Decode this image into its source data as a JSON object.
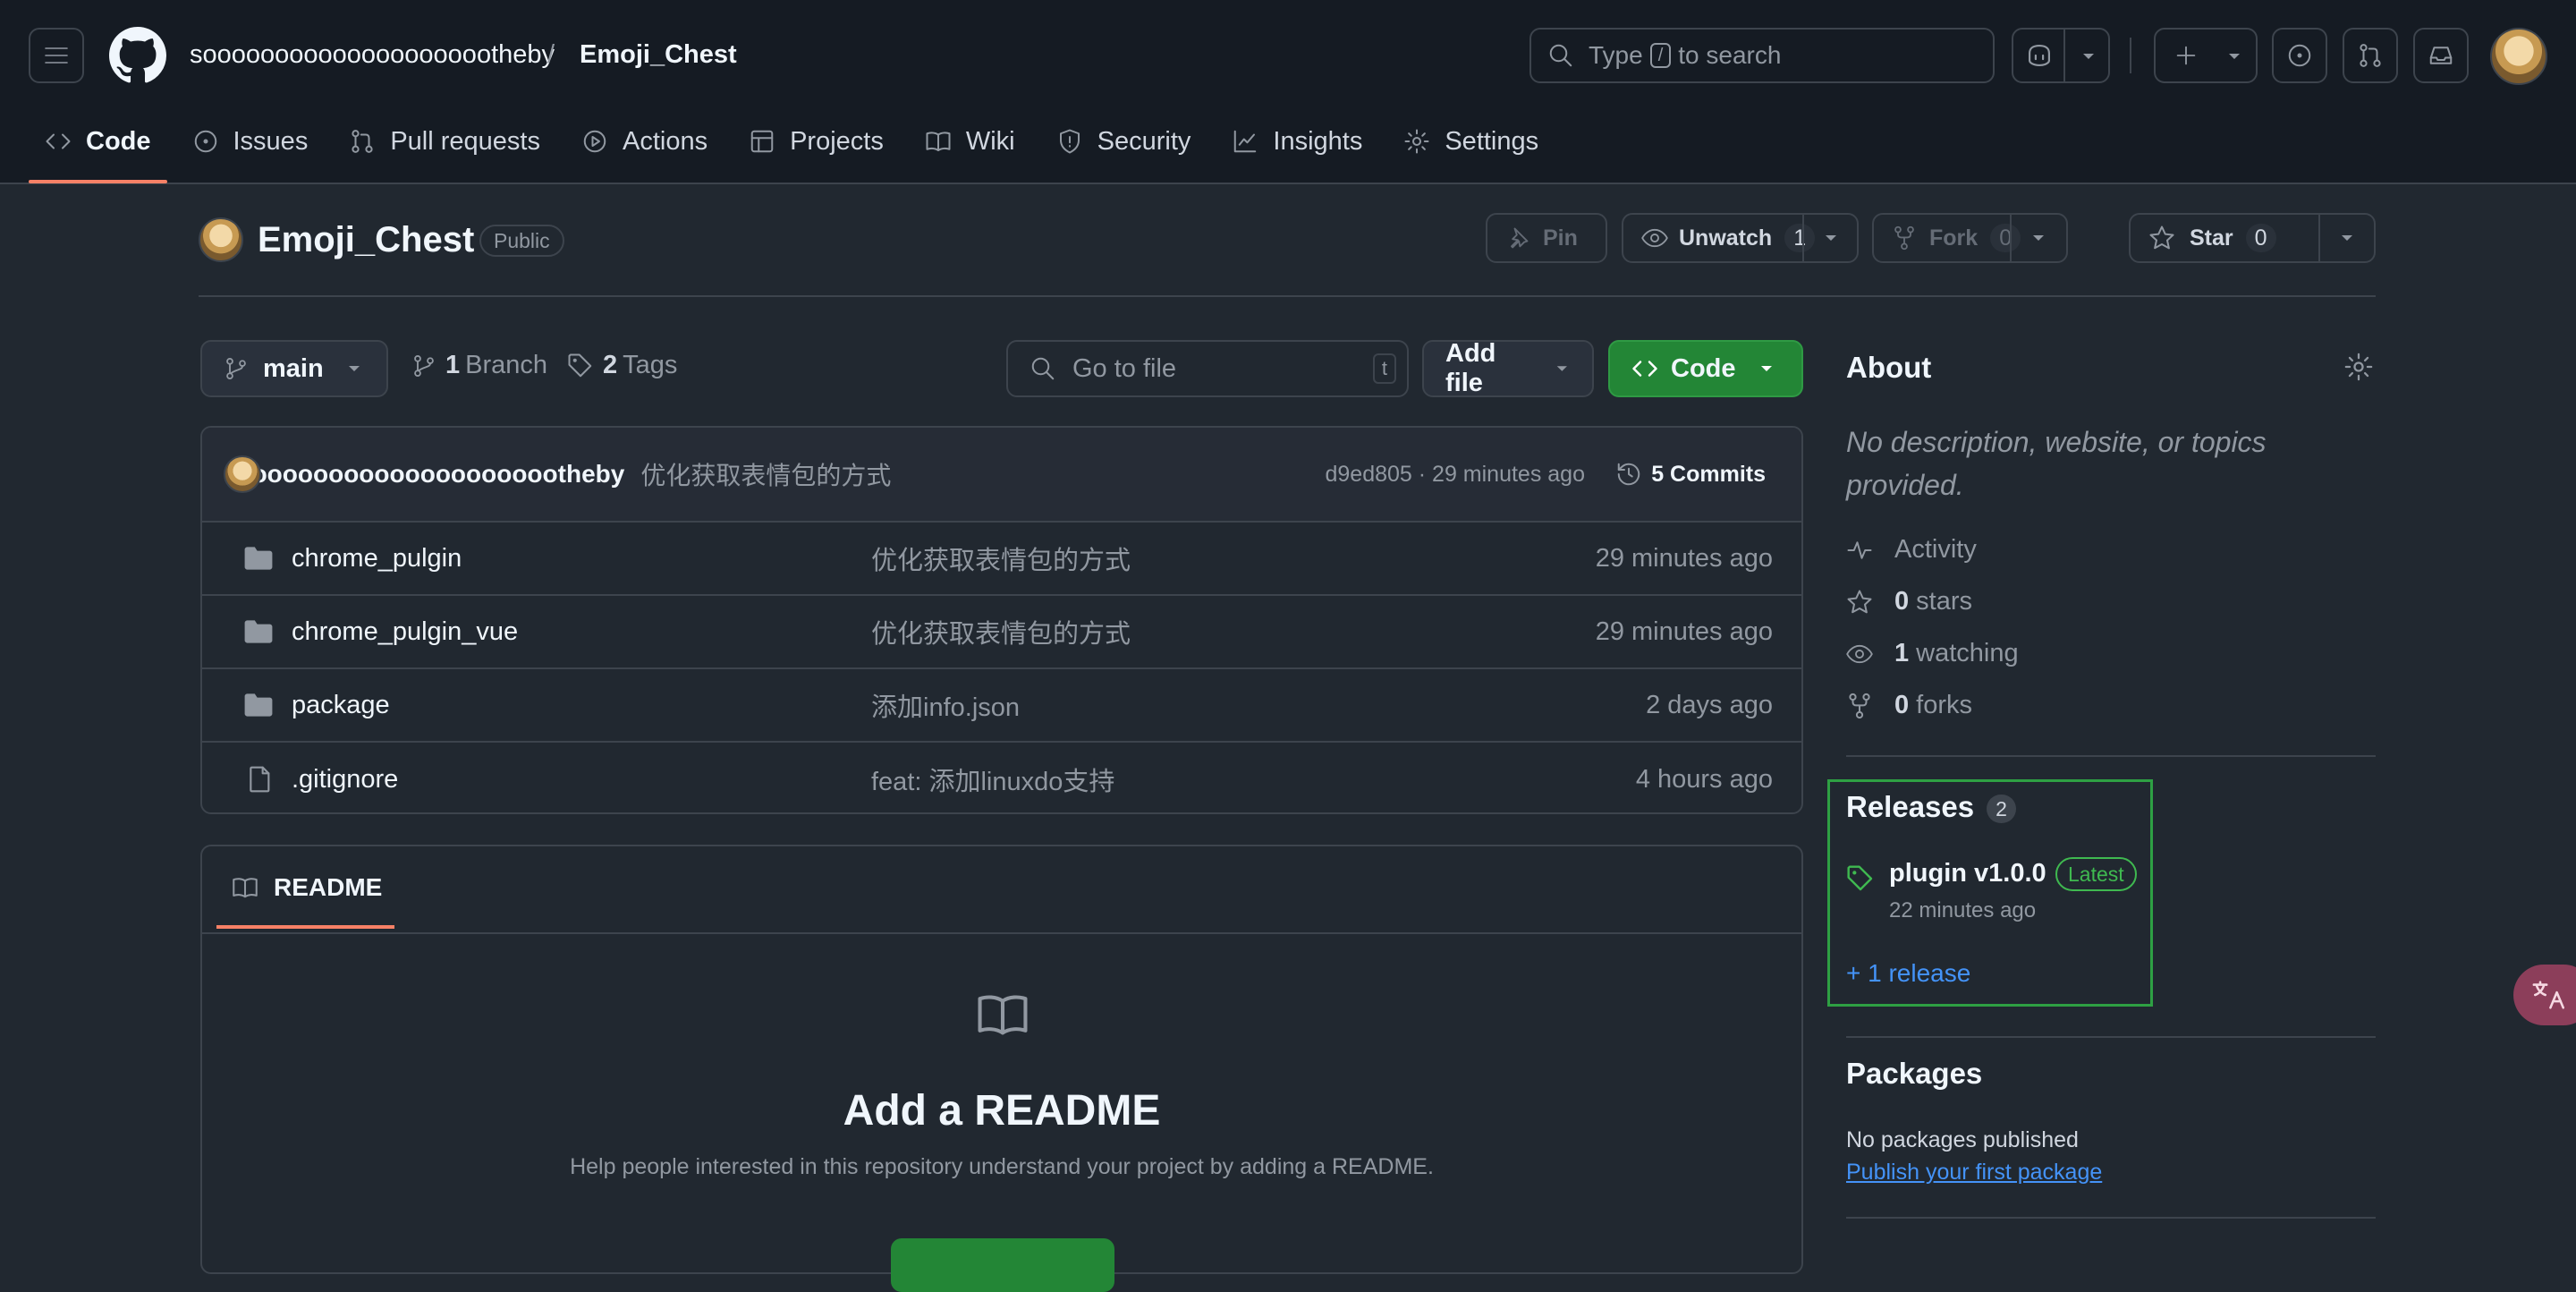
{
  "header": {
    "owner": "sooooooooooooooooooootheby",
    "separator": "/",
    "repo": "Emoji_Chest",
    "search_prefix": "Type",
    "search_key": "/",
    "search_suffix": "to search"
  },
  "tabs": [
    {
      "label": "Code",
      "icon": "code-icon"
    },
    {
      "label": "Issues",
      "icon": "issue-icon"
    },
    {
      "label": "Pull requests",
      "icon": "pull-request-icon"
    },
    {
      "label": "Actions",
      "icon": "play-icon"
    },
    {
      "label": "Projects",
      "icon": "table-icon"
    },
    {
      "label": "Wiki",
      "icon": "book-icon"
    },
    {
      "label": "Security",
      "icon": "shield-icon"
    },
    {
      "label": "Insights",
      "icon": "graph-icon"
    },
    {
      "label": "Settings",
      "icon": "gear-icon"
    }
  ],
  "repo": {
    "name": "Emoji_Chest",
    "visibility": "Public",
    "pin_label": "Pin",
    "watch_label": "Unwatch",
    "watch_count": "1",
    "fork_label": "Fork",
    "fork_count": "0",
    "star_label": "Star",
    "star_count": "0"
  },
  "toolbar": {
    "branch": "main",
    "branch_count": "1",
    "branch_label": "Branch",
    "tag_count": "2",
    "tag_label": "Tags",
    "goto_placeholder": "Go to file",
    "goto_key": "t",
    "add_file": "Add file",
    "code": "Code"
  },
  "commit": {
    "author": "sooooooooooooooooooootheby",
    "message": "优化获取表情包的方式",
    "hash_time": "d9ed805 · 29 minutes ago",
    "commits": "5 Commits"
  },
  "files": [
    {
      "name": "chrome_pulgin",
      "type": "folder",
      "message": "优化获取表情包的方式",
      "time": "29 minutes ago"
    },
    {
      "name": "chrome_pulgin_vue",
      "type": "folder",
      "message": "优化获取表情包的方式",
      "time": "29 minutes ago"
    },
    {
      "name": "package",
      "type": "folder",
      "message": "添加info.json",
      "time": "2 days ago"
    },
    {
      "name": ".gitignore",
      "type": "file",
      "message": "feat: 添加linuxdo支持",
      "time": "4 hours ago"
    }
  ],
  "readme": {
    "tab": "README",
    "title": "Add a README",
    "subtitle": "Help people interested in this repository understand your project by adding a README."
  },
  "about": {
    "heading": "About",
    "description": "No description, website, or topics provided.",
    "activity": "Activity",
    "stars_count": "0",
    "stars_label": "stars",
    "watching_count": "1",
    "watching_label": "watching",
    "forks_count": "0",
    "forks_label": "forks"
  },
  "releases": {
    "heading": "Releases",
    "count": "2",
    "latest_name": "plugin v1.0.0",
    "latest_badge": "Latest",
    "latest_time": "22 minutes ago",
    "more": "+ 1 release"
  },
  "packages": {
    "heading": "Packages",
    "none": "No packages published",
    "publish_link": "Publish your first package"
  },
  "colors": {
    "accent_tab": "#f78166",
    "primary_button": "#238636",
    "link": "#4493f8",
    "highlight_box": "#2ea043"
  }
}
